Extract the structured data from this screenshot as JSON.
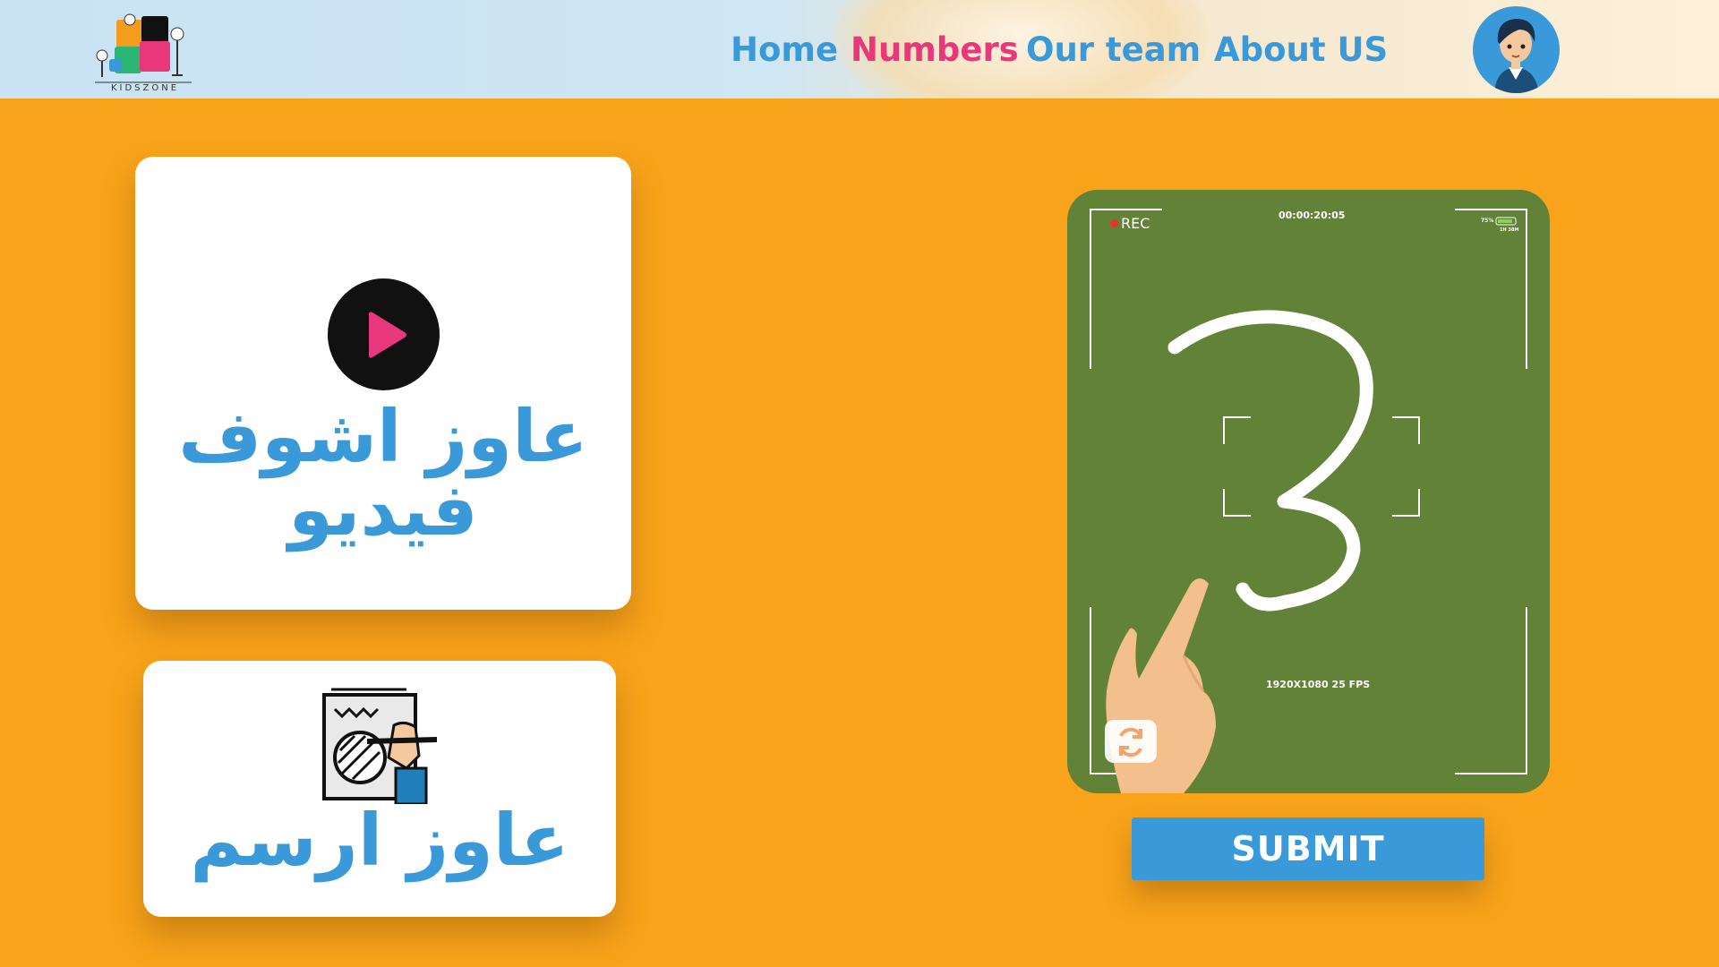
{
  "header": {
    "logo_text": "KIDSZONE",
    "nav": [
      {
        "label": "Home",
        "color": "#3a9ad9"
      },
      {
        "label": "Numbers",
        "color": "#e8377a"
      },
      {
        "label": "Our team",
        "color": "#3a9ad9"
      },
      {
        "label": "About US",
        "color": "#3a9ad9"
      }
    ]
  },
  "cards": {
    "video": {
      "line1": "عاوز اشوف",
      "line2": "فيديو",
      "icon": "play-icon"
    },
    "draw": {
      "label": "عاوز ارسم",
      "icon": "drawing-icon"
    }
  },
  "camera": {
    "rec_label": "REC",
    "timecode": "00:00:20:05",
    "battery_pct": "75%",
    "battery_time": "1H 38M",
    "resolution": "1920X1080 25 FPS",
    "digit": "3",
    "switch_icon": "switch-camera-icon"
  },
  "submit_label": "SUBMIT",
  "colors": {
    "page_bg": "#f9a31a",
    "accent_blue": "#3a9ad9",
    "accent_pink": "#e8377a",
    "camera_green": "#628237",
    "play_pink": "#e8377a"
  }
}
